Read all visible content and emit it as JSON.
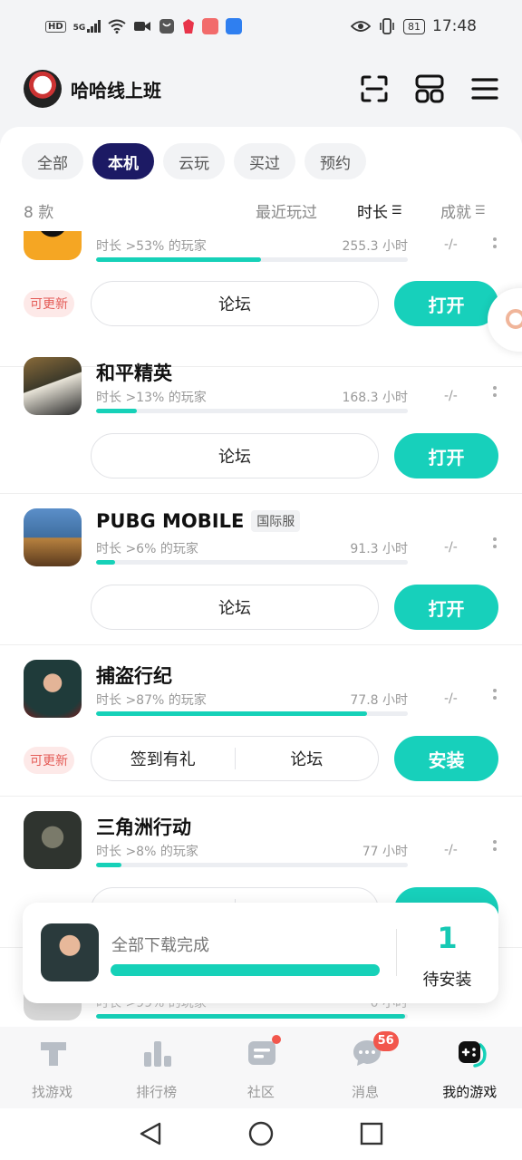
{
  "status_bar": {
    "left_icons": [
      "hd-icon",
      "5g-signal-icon",
      "wifi-icon",
      "video-icon",
      "shopping-bag-icon",
      "app-red-icon",
      "app-pink-icon",
      "cloud-app-icon"
    ],
    "hd_label": "HD",
    "network_label": "5G",
    "battery": "81",
    "time": "17:48"
  },
  "header": {
    "username": "哈哈线上班",
    "icons": [
      "scan-icon",
      "layout-icon",
      "menu-icon"
    ]
  },
  "filters": [
    {
      "label": "全部",
      "active": false
    },
    {
      "label": "本机",
      "active": true
    },
    {
      "label": "云玩",
      "active": false
    },
    {
      "label": "买过",
      "active": false
    },
    {
      "label": "预约",
      "active": false
    }
  ],
  "sort_bar": {
    "count": "8 款",
    "options": [
      {
        "label": "最近玩过",
        "active": false
      },
      {
        "label": "时长",
        "active": true
      },
      {
        "label": "成就",
        "active": false
      }
    ]
  },
  "games": [
    {
      "name": "",
      "tag": "",
      "percent_text": "时长 >53% 的玩家",
      "hours": "255.3 小时",
      "progress": 0.53,
      "achievement": "-/-",
      "badge": "可更新",
      "buttons": [
        "论坛"
      ],
      "action": "打开",
      "colors": [
        "#f5a623",
        "#1e90ff"
      ]
    },
    {
      "name": "和平精英",
      "tag": "",
      "percent_text": "时长 >13% 的玩家",
      "hours": "168.3 小时",
      "progress": 0.13,
      "achievement": "-/-",
      "badge": "",
      "buttons": [
        "论坛"
      ],
      "action": "打开",
      "colors": [
        "#6b7a4a",
        "#d9b36a"
      ]
    },
    {
      "name": "PUBG MOBILE",
      "tag": "国际服",
      "percent_text": "时长 >6% 的玩家",
      "hours": "91.3 小时",
      "progress": 0.06,
      "achievement": "-/-",
      "badge": "",
      "buttons": [
        "论坛"
      ],
      "action": "打开",
      "colors": [
        "#4a7fb5",
        "#c98b3a"
      ]
    },
    {
      "name": "捕盗行纪",
      "tag": "",
      "percent_text": "时长 >87% 的玩家",
      "hours": "77.8 小时",
      "progress": 0.87,
      "achievement": "-/-",
      "badge": "可更新",
      "buttons": [
        "签到有礼",
        "论坛"
      ],
      "action": "安装",
      "colors": [
        "#1f3b3a",
        "#c0392b"
      ]
    },
    {
      "name": "三角洲行动",
      "tag": "",
      "percent_text": "时长 >8% 的玩家",
      "hours": "77 小时",
      "progress": 0.08,
      "achievement": "-/-",
      "badge": "",
      "buttons": [
        "",
        ""
      ],
      "action": "",
      "colors": [
        "#3a3f3a",
        "#8a6d4b"
      ]
    },
    {
      "name": "",
      "tag": "",
      "percent_text": "时长 >99% 的玩家",
      "hours": "0 小时",
      "progress": 0.99,
      "achievement": "-/-",
      "badge": "",
      "buttons": [],
      "action": "",
      "colors": [
        "#d8d8d8",
        "#999999"
      ]
    }
  ],
  "download_banner": {
    "title": "全部下载完成",
    "progress": 1.0,
    "count": "1",
    "label": "待安装"
  },
  "bottom_nav": [
    {
      "label": "找游戏",
      "icon": "find-game-icon",
      "active": false,
      "badge": ""
    },
    {
      "label": "排行榜",
      "icon": "ranking-icon",
      "active": false,
      "badge": ""
    },
    {
      "label": "社区",
      "icon": "community-icon",
      "active": false,
      "badge": "dot"
    },
    {
      "label": "消息",
      "icon": "message-icon",
      "active": false,
      "badge": "56"
    },
    {
      "label": "我的游戏",
      "icon": "my-games-icon",
      "active": true,
      "badge": ""
    }
  ],
  "colors": {
    "accent": "#16d1b8",
    "active_chip": "#1c1a64",
    "update_badge_bg": "#fde9e8",
    "update_badge_text": "#e45c57",
    "notification_red": "#f2564c"
  }
}
